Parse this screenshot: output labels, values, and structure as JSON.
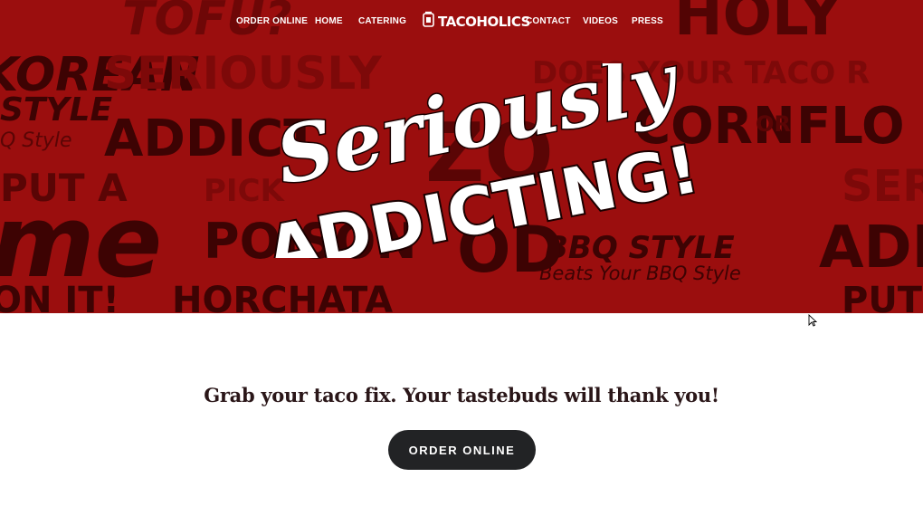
{
  "nav": {
    "order_online": "ORDER ONLINE",
    "home": "HOME",
    "catering": "CATERING",
    "logo": "TACOHOLICS",
    "contact": "CONTACT",
    "videos": "VIDEOS",
    "press": "PRESS"
  },
  "hero": {
    "headline_script": "Seriously",
    "headline_bold": "ADDICTING!",
    "background_words": [
      "TOFU?",
      "HOLY",
      "KOREAN",
      "SERIOUSLY",
      "DOES YOUR TACO R",
      "STYLE",
      "Q Style",
      "ADDICT",
      "CORN",
      "OR",
      "FLO",
      "PUT A",
      "PICK",
      "POISON",
      "me",
      "BBQ STYLE",
      "Beats Your BBQ Style",
      "SER",
      "ADD",
      "HORCHATA",
      "ON IT!",
      "PUT",
      "ZO",
      "OD"
    ],
    "bg_color": "#9b0e0e"
  },
  "main": {
    "tagline": "Grab your taco fix. Your tastebuds will thank you!",
    "order_button": "ORDER ONLINE"
  }
}
